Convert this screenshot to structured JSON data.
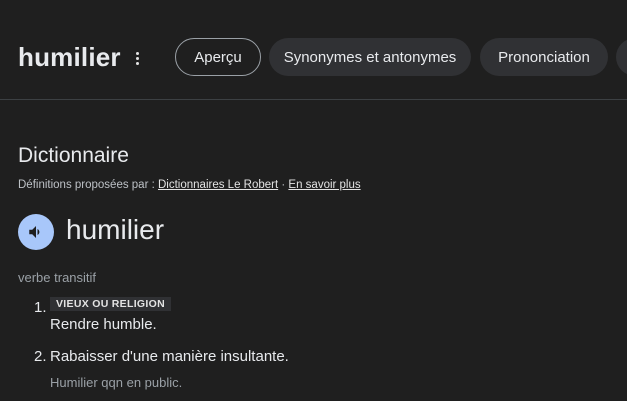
{
  "header": {
    "query": "humilier",
    "more_icon": "more-vert-icon",
    "tabs": [
      {
        "label": "Aperçu",
        "active": true
      },
      {
        "label": "Synonymes et antonymes",
        "active": false
      },
      {
        "label": "Prononciation",
        "active": false
      }
    ]
  },
  "dictionary": {
    "section_title": "Dictionnaire",
    "source_prefix": "Définitions proposées par : ",
    "source_link": "Dictionnaires Le Robert",
    "separator": " · ",
    "learn_more": "En savoir plus",
    "speaker_icon": "speaker-icon",
    "word": "humilier",
    "part_of_speech": "verbe transitif",
    "definitions": [
      {
        "number": "1.",
        "label": "VIEUX OU RELIGION",
        "text": "Rendre humble."
      },
      {
        "number": "2.",
        "text": "Rabaisser d'une manière insultante.",
        "example": "Humilier qqn en public."
      }
    ]
  },
  "colors": {
    "background": "#1f1f1f",
    "tab_background": "#303134",
    "speaker_accent": "#a8c7fa"
  }
}
